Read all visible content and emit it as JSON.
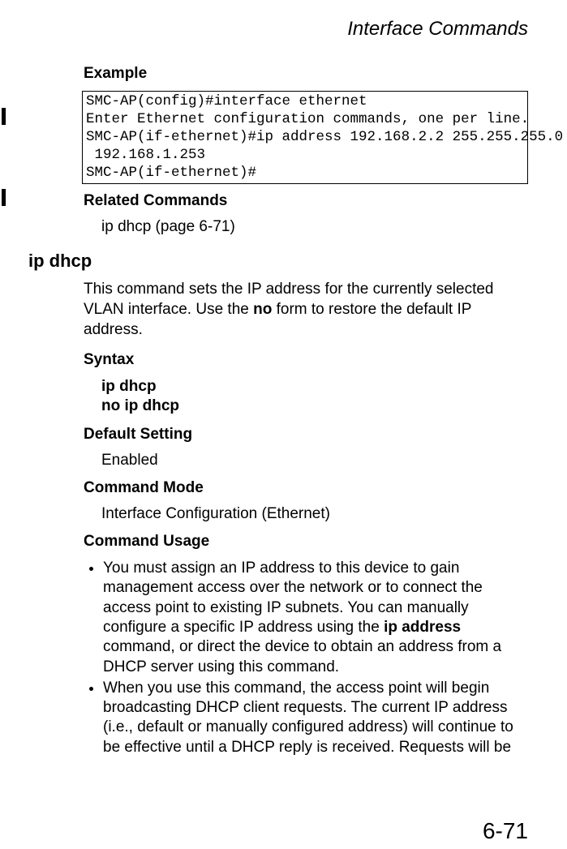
{
  "header": {
    "title": "Interface Commands"
  },
  "page_number": "6-71",
  "example": {
    "label": "Example",
    "code": "SMC-AP(config)#interface ethernet\nEnter Ethernet configuration commands, one per line.\nSMC-AP(if-ethernet)#ip address 192.168.2.2 255.255.255.0\n 192.168.1.253\nSMC-AP(if-ethernet)#"
  },
  "related": {
    "label": "Related Commands",
    "text": "ip dhcp (page 6-71)"
  },
  "command": {
    "name": "ip dhcp",
    "desc_pre": "This command sets the IP address for the currently selected VLAN interface. Use the ",
    "desc_bold": "no",
    "desc_post": " form to restore the default IP address."
  },
  "syntax": {
    "label": "Syntax",
    "line1": "ip dhcp",
    "line2": "no ip dhcp"
  },
  "default_setting": {
    "label": "Default Setting",
    "value": "Enabled"
  },
  "command_mode": {
    "label": "Command Mode",
    "value": "Interface Configuration (Ethernet)"
  },
  "usage": {
    "label": "Command Usage",
    "items": [
      {
        "pre": "You must assign an IP address to this device to gain management access over the network or to connect the access point to existing IP subnets. You can manually configure a specific IP address using the ",
        "bold": "ip address",
        "post": " command, or direct the device to obtain an address from a DHCP server using this command."
      },
      {
        "pre": "When you use this command, the access point will begin broadcasting DHCP client requests. The current IP address (i.e., default or manually configured address) will continue to be effective until a DHCP reply is received. Requests will be",
        "bold": "",
        "post": ""
      }
    ]
  }
}
